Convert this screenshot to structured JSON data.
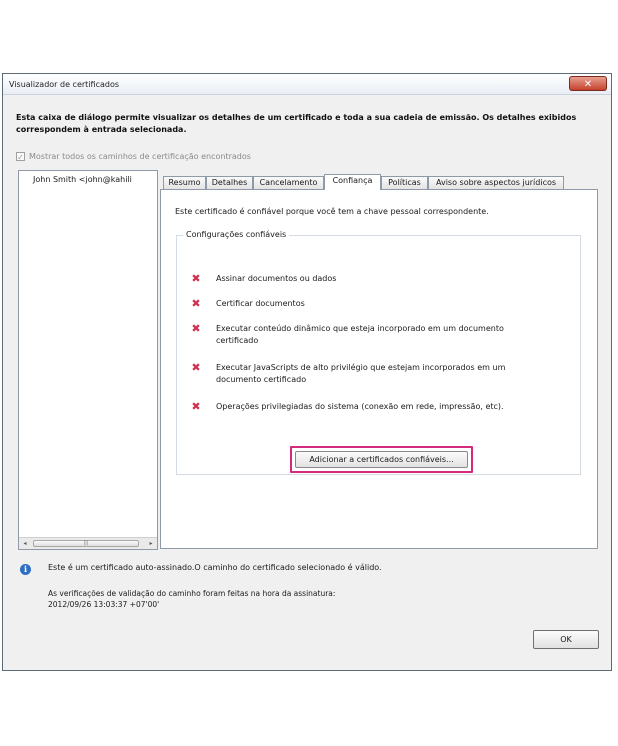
{
  "window": {
    "title": "Visualizador de certificados",
    "close_glyph": "✕"
  },
  "intro_text": "Esta caixa de diálogo permite visualizar os detalhes de um certificado e toda a sua cadeia de emissão. Os detalhes exibidos correspondem à entrada selecionada.",
  "show_all": {
    "label": "Mostrar todos os caminhos de certificação encontrados",
    "checked": true,
    "check_glyph": "✓"
  },
  "tree": {
    "items": [
      "John Smith <john@kahili"
    ],
    "scroll_left": "◂",
    "scroll_right": "▸",
    "thumb_grip": "|||"
  },
  "tabs": [
    {
      "label": "Resumo"
    },
    {
      "label": "Detalhes"
    },
    {
      "label": "Cancelamento"
    },
    {
      "label": "Confiança",
      "active": true
    },
    {
      "label": "Políticas"
    },
    {
      "label": "Aviso sobre aspectos jurídicos"
    }
  ],
  "trust_panel": {
    "description": "Este certificado é confiável porque você tem a chave pessoal correspondente.",
    "group_title": "Configurações confiáveis",
    "permissions": [
      "Assinar documentos ou dados",
      "Certificar documentos",
      "Executar conteúdo dinâmico que esteja incorporado em um documento certificado",
      "Executar JavaScripts de alto privilégio que estejam incorporados em um documento certificado",
      "Operações privilegiadas do sistema (conexão em rede, impressão, etc)."
    ],
    "denied_glyph": "✖",
    "add_button": "Adicionar a certificados confiáveis..."
  },
  "footer": {
    "info_glyph": "i",
    "status": "Este é um certificado auto-assinado.O caminho do certificado selecionado é válido.",
    "validation_label": "As verificações de validação do caminho foram feitas na hora da assinatura:",
    "validation_time": "2012/09/26 13:03:37 +07'00'",
    "ok_button": "OK"
  },
  "colors": {
    "highlight_border": "#d42a7d",
    "denied_icon": "#d0314e",
    "info_icon": "#2e6fc4"
  }
}
